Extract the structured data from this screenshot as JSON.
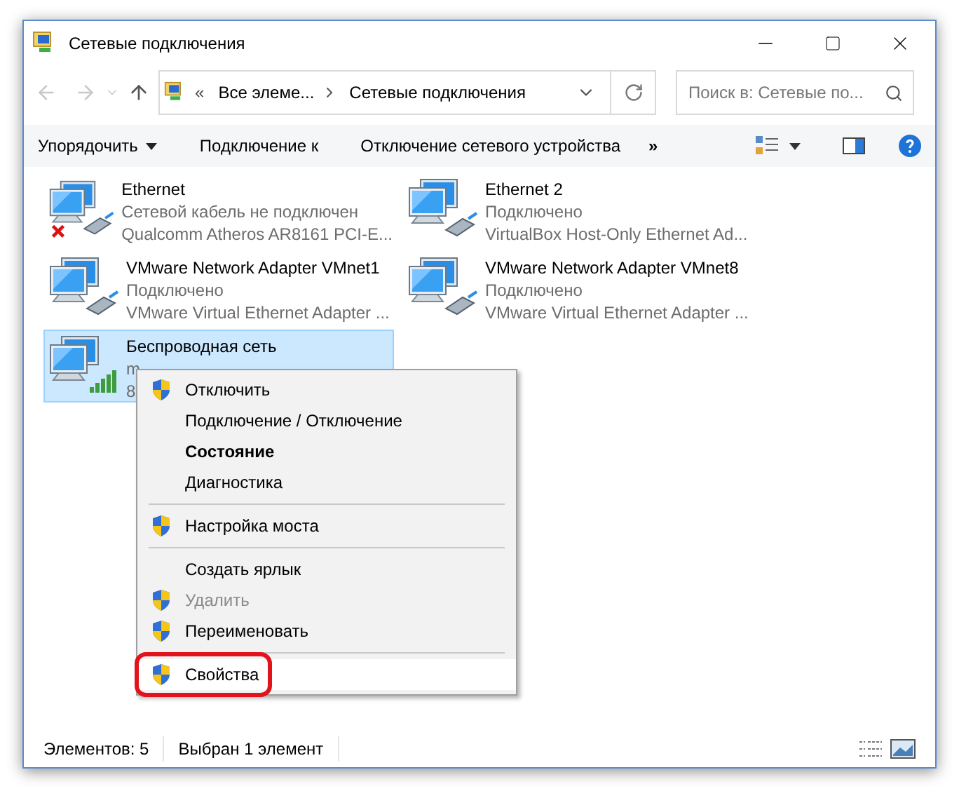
{
  "window": {
    "title": "Сетевые подключения"
  },
  "address": {
    "overflow": "«",
    "crumbs": [
      "Все элеме...",
      "Сетевые подключения"
    ]
  },
  "search": {
    "placeholder": "Поиск в: Сетевые по..."
  },
  "toolbar": {
    "items": [
      "Упорядочить",
      "Подключение к",
      "Отключение сетевого устройства"
    ],
    "more": "»"
  },
  "connections": [
    {
      "name": "Ethernet",
      "status": "Сетевой кабель не подключен",
      "adapter": "Qualcomm Atheros AR8161 PCI-E...",
      "kind": "wired",
      "disconnected": true,
      "selected": false
    },
    {
      "name": "Ethernet 2",
      "status": "Подключено",
      "adapter": "VirtualBox Host-Only Ethernet Ad...",
      "kind": "wired",
      "disconnected": false,
      "selected": false
    },
    {
      "name": "VMware Network Adapter VMnet1",
      "status": "Подключено",
      "adapter": "VMware Virtual Ethernet Adapter ...",
      "kind": "wired",
      "disconnected": false,
      "selected": false
    },
    {
      "name": "VMware Network Adapter VMnet8",
      "status": "Подключено",
      "adapter": "VMware Virtual Ethernet Adapter ...",
      "kind": "wired",
      "disconnected": false,
      "selected": false
    },
    {
      "name": "Беспроводная сеть",
      "status": "m",
      "adapter": "8",
      "kind": "wireless",
      "disconnected": false,
      "selected": true
    }
  ],
  "context_menu": [
    {
      "kind": "item",
      "label": "Отключить",
      "shield": true,
      "bold": false,
      "disabled": false,
      "selected": false,
      "outlined": false
    },
    {
      "kind": "item",
      "label": "Подключение / Отключение",
      "shield": false,
      "bold": false,
      "disabled": false,
      "selected": false,
      "outlined": false
    },
    {
      "kind": "item",
      "label": "Состояние",
      "shield": false,
      "bold": true,
      "disabled": false,
      "selected": false,
      "outlined": false
    },
    {
      "kind": "item",
      "label": "Диагностика",
      "shield": false,
      "bold": false,
      "disabled": false,
      "selected": false,
      "outlined": false
    },
    {
      "kind": "separator"
    },
    {
      "kind": "item",
      "label": "Настройка моста",
      "shield": true,
      "bold": false,
      "disabled": false,
      "selected": false,
      "outlined": false
    },
    {
      "kind": "separator"
    },
    {
      "kind": "item",
      "label": "Создать ярлык",
      "shield": false,
      "bold": false,
      "disabled": false,
      "selected": false,
      "outlined": false
    },
    {
      "kind": "item",
      "label": "Удалить",
      "shield": true,
      "bold": false,
      "disabled": true,
      "selected": false,
      "outlined": false
    },
    {
      "kind": "item",
      "label": "Переименовать",
      "shield": true,
      "bold": false,
      "disabled": false,
      "selected": false,
      "outlined": false
    },
    {
      "kind": "separator"
    },
    {
      "kind": "item",
      "label": "Свойства",
      "shield": true,
      "bold": false,
      "disabled": false,
      "selected": true,
      "outlined": true
    }
  ],
  "status_bar": [
    "Элементов: 5",
    "Выбран 1 элемент"
  ]
}
